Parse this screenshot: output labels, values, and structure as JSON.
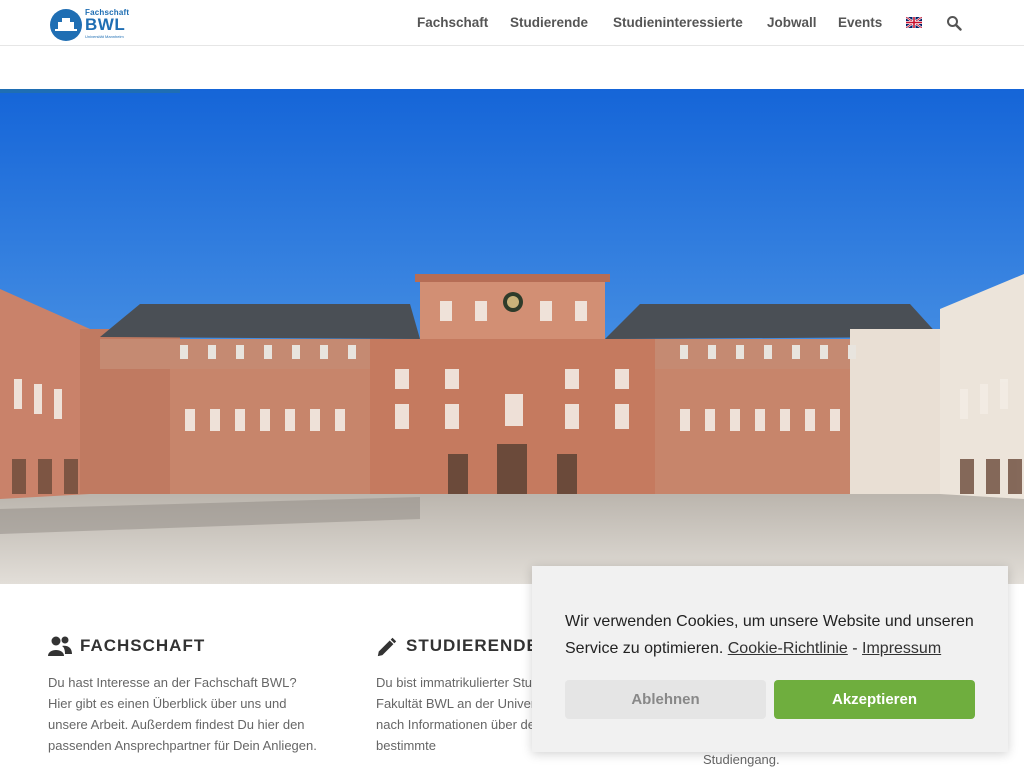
{
  "header": {
    "logo": {
      "small": "Fachschaft",
      "big": "BWL",
      "tiny": "Universität Mannheim"
    },
    "nav": [
      {
        "label": "Fachschaft"
      },
      {
        "label": "Studierende"
      },
      {
        "label": "Studieninteressierte"
      },
      {
        "label": "Jobwall"
      },
      {
        "label": "Events"
      }
    ],
    "language_icon": "uk-flag-icon",
    "search_icon": "search-icon"
  },
  "hero": {
    "image": "mannheim-palace-photo"
  },
  "columns": [
    {
      "title": "FACHSCHAFT",
      "icon": "people-icon",
      "text": "Du hast Interesse an der Fachschaft BWL? Hier gibt es einen Überblick über uns und unsere Arbeit. Außerdem findest Du hier den passenden Ansprechpartner für Dein Anliegen."
    },
    {
      "title": "STUDIERENDE",
      "icon": "pencil-icon",
      "text": "Du bist immatrikulierter Student an der Fakultät BWL an der Universität und suchst nach Informationen über dein Studium oder bestimmte"
    },
    {
      "tail": "Studiengang."
    }
  ],
  "cookie": {
    "text": "Wir verwenden Cookies, um unsere Website und unseren Service zu optimieren.",
    "link_policy": "Cookie-Richtlinie",
    "separator": "-",
    "link_imprint": "Impressum",
    "deny_label": "Ablehnen",
    "accept_label": "Akzeptieren",
    "accept_color": "#6fae3e"
  }
}
